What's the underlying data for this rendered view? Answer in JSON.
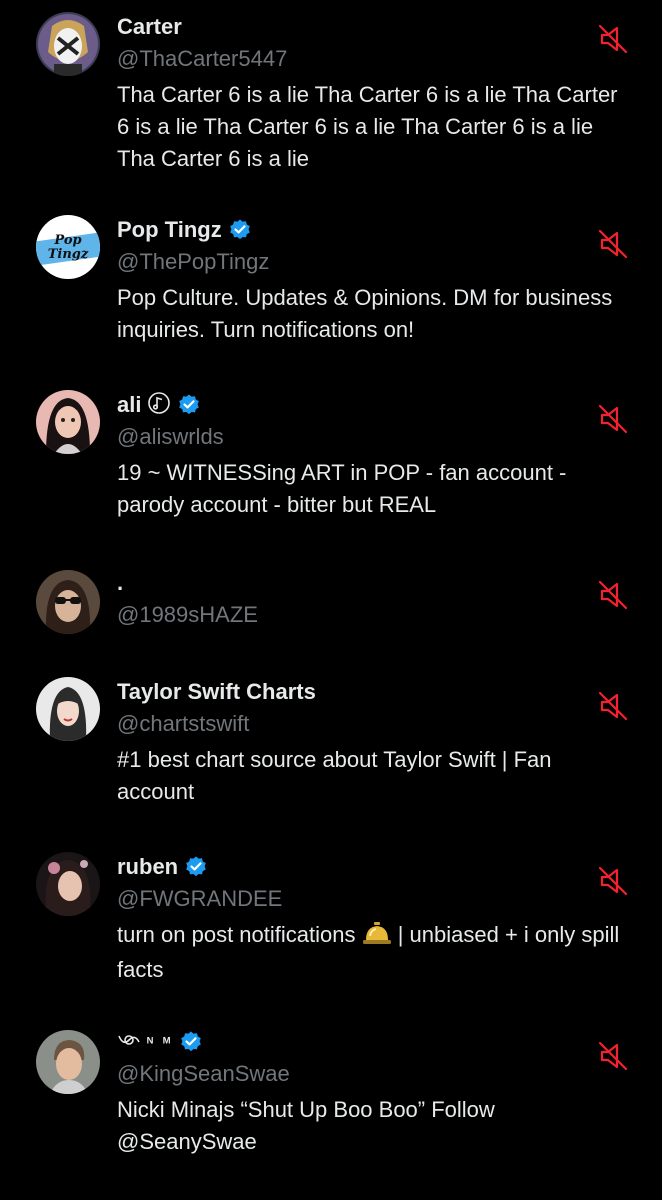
{
  "accounts": [
    {
      "name": "Carter",
      "handle": "@ThaCarter5447",
      "bio": "Tha Carter 6 is a lie Tha Carter 6 is a lie Tha Carter 6 is a lie Tha Carter 6 is a lie Tha Carter 6 is a lie Tha Carter 6 is a lie",
      "verified": false,
      "avatar_icon": "avatar-carter"
    },
    {
      "name": "Pop Tingz",
      "handle": "@ThePopTingz",
      "bio": "Pop Culture. Updates & Opinions. DM for business inquiries. Turn notifications on!",
      "verified": true,
      "avatar_text": "Pop Tingz"
    },
    {
      "name": "ali",
      "handle": "@aliswrlds",
      "bio": "19 ~ WITNESSing ART in POP - fan account - parody account - bitter but REAL",
      "verified": true,
      "name_icon": "musical-note-icon"
    },
    {
      "name": ".",
      "handle": "@1989sHAZE",
      "bio": "",
      "verified": false
    },
    {
      "name": "Taylor Swift Charts",
      "handle": "@chartstswift",
      "bio": "#1 best chart source about Taylor Swift | Fan account",
      "verified": false
    },
    {
      "name": "ruben",
      "handle": "@FWGRANDEE",
      "bio_before_emoji": "turn on post notifications ",
      "bio_after_emoji": " | unbiased + i only spill facts",
      "bio_emoji": "bellhop-bell-icon",
      "verified": true
    },
    {
      "name": "ᴺ ᴹ",
      "name_prefix_icon": "loop-icon",
      "handle": "@KingSeanSwae",
      "bio": "Nicki Minajs “Shut Up Boo Boo” Follow @SeanySwae",
      "verified": true
    }
  ],
  "colors": {
    "background": "#000000",
    "primary_text": "#e7e9ea",
    "secondary_text": "#71767b",
    "verified_blue": "#1d9bf0",
    "muted_red": "#f4212e"
  },
  "icons": {
    "mute": "muted-speaker-icon",
    "verified": "verified-badge-icon"
  }
}
